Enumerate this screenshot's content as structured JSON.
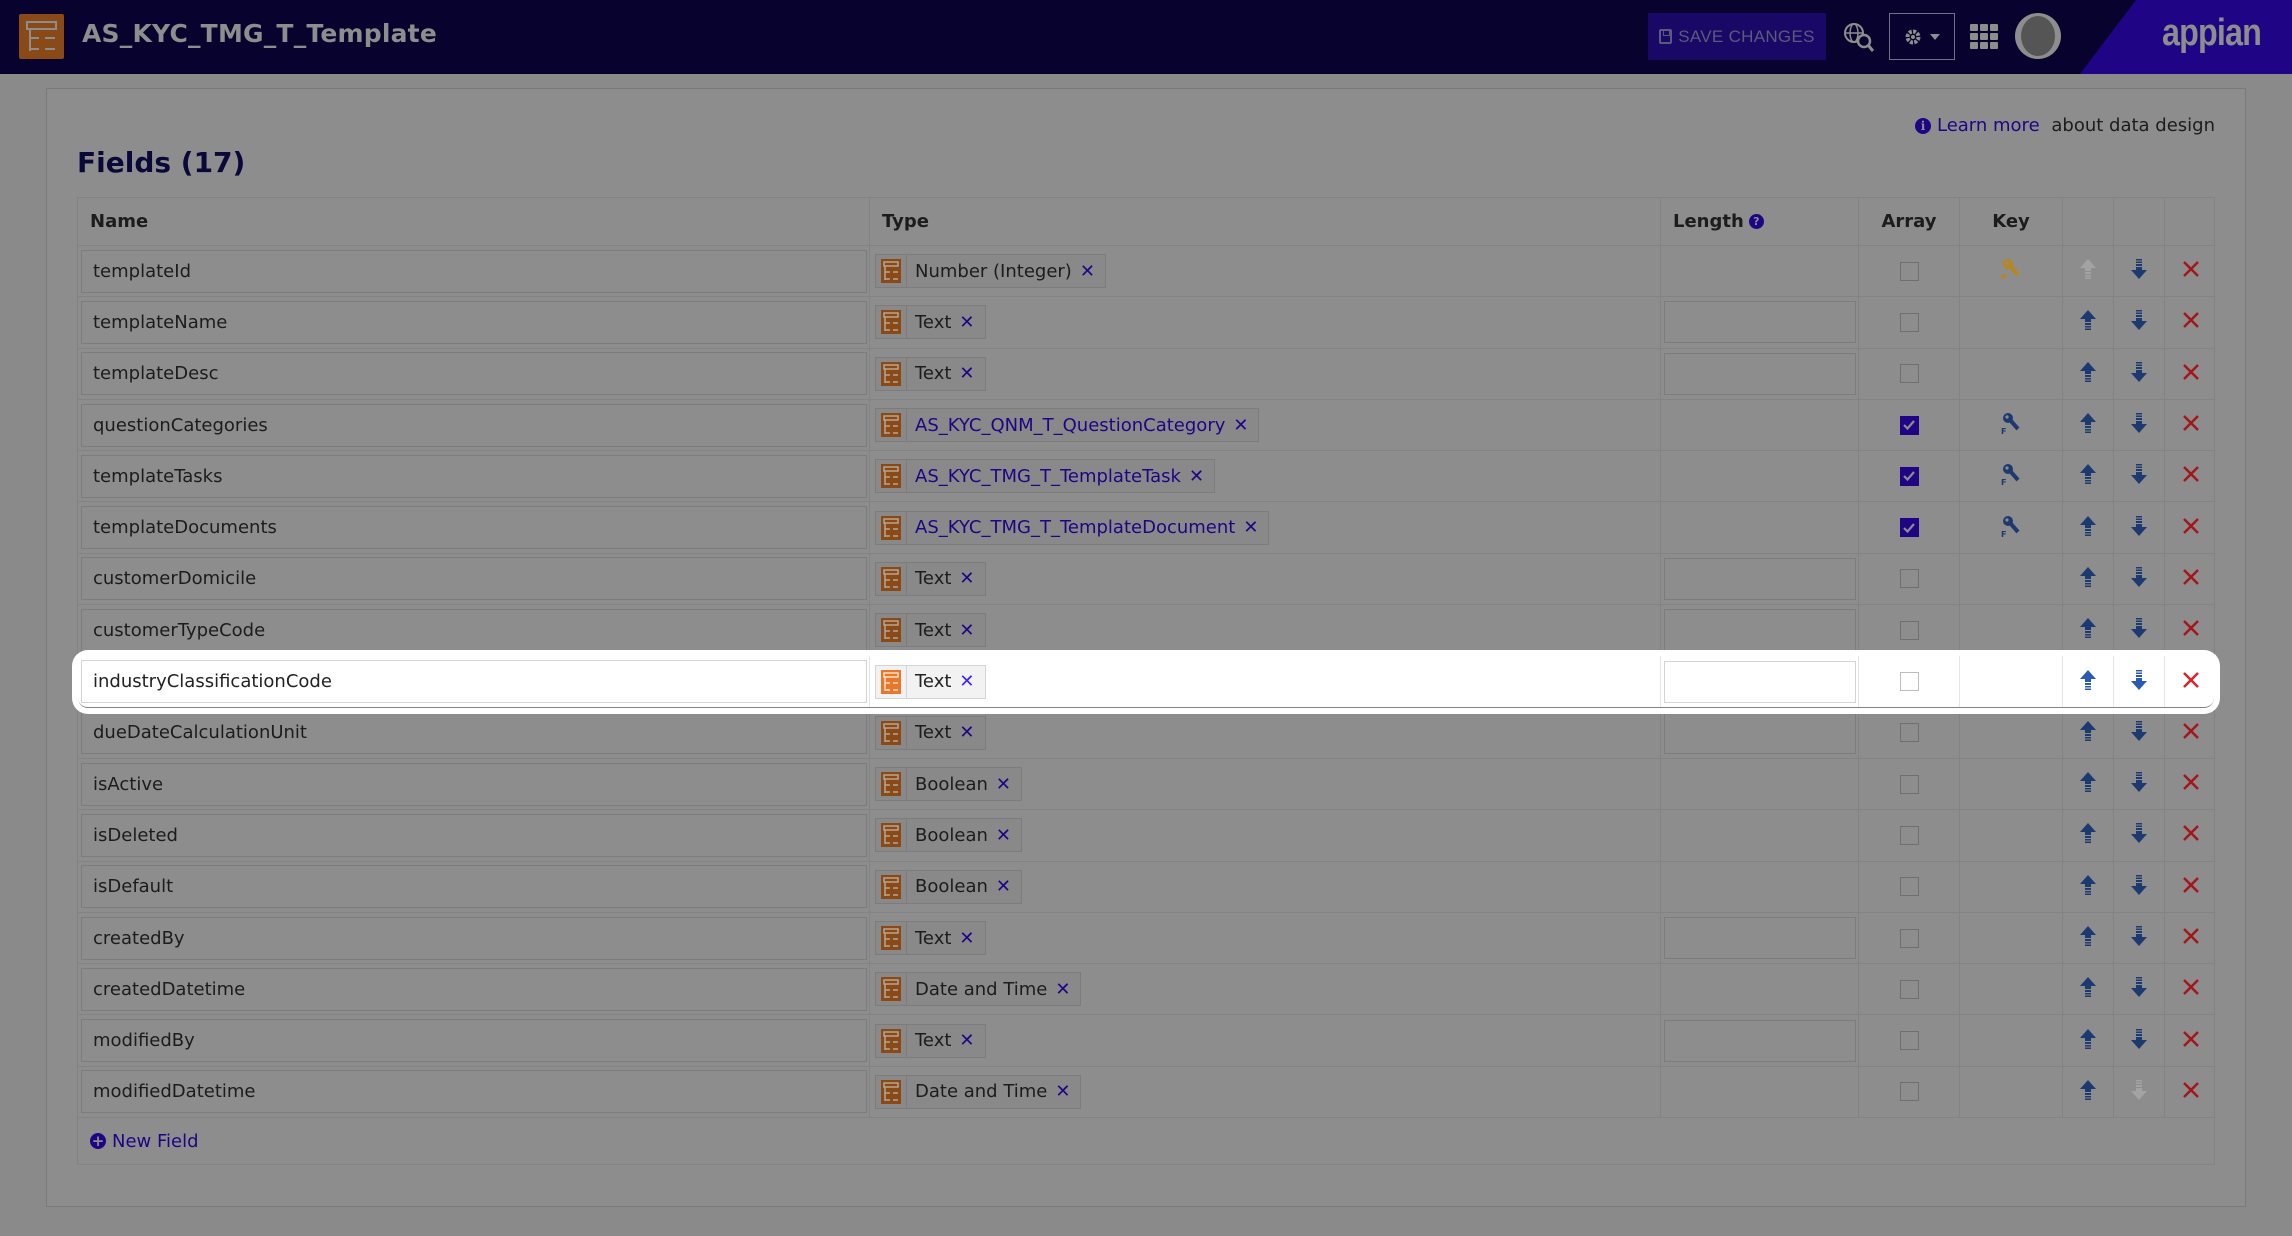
{
  "header": {
    "app_title": "AS_KYC_TMG_T_Template",
    "save_label": "SAVE CHANGES",
    "brand": "appian",
    "colors": {
      "bar": "#07032e",
      "brand_bg": "#1f0585",
      "accent": "#1f0585",
      "type_icon": "#8a4a18",
      "delete": "#a3161b",
      "arrow": "#1d3a70",
      "key_primary": "#b8861c"
    }
  },
  "learn": {
    "link": "Learn more",
    "suffix": " about data design"
  },
  "fields_title": "Fields (17)",
  "columns": {
    "name": "Name",
    "type": "Type",
    "length": "Length",
    "array": "Array",
    "key": "Key"
  },
  "rows": [
    {
      "name": "templateId",
      "type": "Number (Integer)",
      "type_link": false,
      "has_length": false,
      "array": false,
      "key": "P",
      "up_enabled": false,
      "down_enabled": true
    },
    {
      "name": "templateName",
      "type": "Text",
      "type_link": false,
      "has_length": true,
      "array": false,
      "key": "",
      "up_enabled": true,
      "down_enabled": true
    },
    {
      "name": "templateDesc",
      "type": "Text",
      "type_link": false,
      "has_length": true,
      "array": false,
      "key": "",
      "up_enabled": true,
      "down_enabled": true
    },
    {
      "name": "questionCategories",
      "type": "AS_KYC_QNM_T_QuestionCategory",
      "type_link": true,
      "has_length": false,
      "array": true,
      "key": "F",
      "up_enabled": true,
      "down_enabled": true
    },
    {
      "name": "templateTasks",
      "type": "AS_KYC_TMG_T_TemplateTask",
      "type_link": true,
      "has_length": false,
      "array": true,
      "key": "F",
      "up_enabled": true,
      "down_enabled": true
    },
    {
      "name": "templateDocuments",
      "type": "AS_KYC_TMG_T_TemplateDocument",
      "type_link": true,
      "has_length": false,
      "array": true,
      "key": "F",
      "up_enabled": true,
      "down_enabled": true
    },
    {
      "name": "customerDomicile",
      "type": "Text",
      "type_link": false,
      "has_length": true,
      "array": false,
      "key": "",
      "up_enabled": true,
      "down_enabled": true
    },
    {
      "name": "customerTypeCode",
      "type": "Text",
      "type_link": false,
      "has_length": true,
      "array": false,
      "key": "",
      "up_enabled": true,
      "down_enabled": true
    },
    {
      "name": "industryClassificationCode",
      "type": "Text",
      "type_link": false,
      "has_length": true,
      "array": false,
      "key": "",
      "up_enabled": true,
      "down_enabled": true,
      "highlighted": true
    },
    {
      "name": "dueDateCalculationUnit",
      "type": "Text",
      "type_link": false,
      "has_length": true,
      "array": false,
      "key": "",
      "up_enabled": true,
      "down_enabled": true
    },
    {
      "name": "isActive",
      "type": "Boolean",
      "type_link": false,
      "has_length": false,
      "array": false,
      "key": "",
      "up_enabled": true,
      "down_enabled": true
    },
    {
      "name": "isDeleted",
      "type": "Boolean",
      "type_link": false,
      "has_length": false,
      "array": false,
      "key": "",
      "up_enabled": true,
      "down_enabled": true
    },
    {
      "name": "isDefault",
      "type": "Boolean",
      "type_link": false,
      "has_length": false,
      "array": false,
      "key": "",
      "up_enabled": true,
      "down_enabled": true
    },
    {
      "name": "createdBy",
      "type": "Text",
      "type_link": false,
      "has_length": true,
      "array": false,
      "key": "",
      "up_enabled": true,
      "down_enabled": true
    },
    {
      "name": "createdDatetime",
      "type": "Date and Time",
      "type_link": false,
      "has_length": false,
      "array": false,
      "key": "",
      "up_enabled": true,
      "down_enabled": true
    },
    {
      "name": "modifiedBy",
      "type": "Text",
      "type_link": false,
      "has_length": true,
      "array": false,
      "key": "",
      "up_enabled": true,
      "down_enabled": true
    },
    {
      "name": "modifiedDatetime",
      "type": "Date and Time",
      "type_link": false,
      "has_length": false,
      "array": false,
      "key": "",
      "up_enabled": true,
      "down_enabled": false
    }
  ],
  "new_field_label": "New Field"
}
